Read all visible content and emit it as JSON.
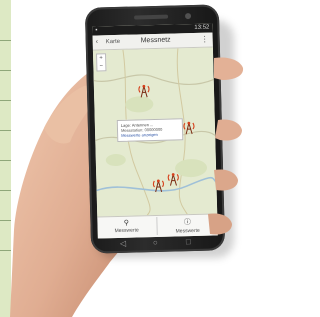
{
  "status_bar": {
    "time": "13:52"
  },
  "app": {
    "back_label": "Karte",
    "title": "Messnetz",
    "menu_icon": "overflow-menu-icon"
  },
  "map": {
    "zoom_in": "+",
    "zoom_out": "−",
    "markers": [
      "antenna-marker",
      "antenna-marker",
      "antenna-marker",
      "antenna-marker"
    ],
    "popup": {
      "line1": "Lage: Antennen ...",
      "line2": "Messstation: 00000000",
      "line3": "Messwerte anzeigen"
    }
  },
  "bottom_bar": {
    "left_button": "Messwerte",
    "right_button": "Messwerte"
  },
  "colors": {
    "map_bg": "#e4ead0",
    "marker": "#d6401b",
    "phone_body": "#1b1b1b",
    "skin": "#e6b89c"
  }
}
